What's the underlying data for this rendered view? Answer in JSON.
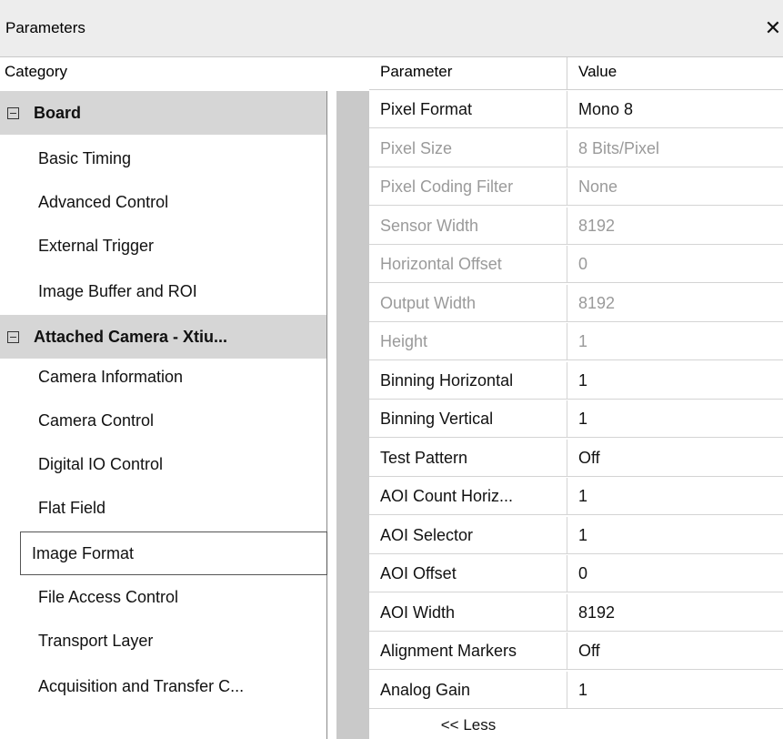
{
  "window": {
    "title": "Parameters",
    "close_glyph": "✕"
  },
  "headers": {
    "category": "Category",
    "parameter": "Parameter",
    "value": "Value"
  },
  "categories": [
    {
      "label": "Board",
      "type": "group"
    },
    {
      "label": "Basic Timing",
      "type": "item"
    },
    {
      "label": "Advanced Control",
      "type": "item"
    },
    {
      "label": "External Trigger",
      "type": "item"
    },
    {
      "label": "Image Buffer and ROI",
      "type": "item"
    },
    {
      "label": "Attached Camera - Xtiu...",
      "type": "group"
    },
    {
      "label": "Camera Information",
      "type": "item"
    },
    {
      "label": "Camera Control",
      "type": "item"
    },
    {
      "label": "Digital IO Control",
      "type": "item"
    },
    {
      "label": "Flat Field",
      "type": "item"
    },
    {
      "label": "Image Format",
      "type": "item",
      "selected": true
    },
    {
      "label": "File Access Control",
      "type": "item"
    },
    {
      "label": "Transport Layer",
      "type": "item"
    },
    {
      "label": "Acquisition and Transfer C...",
      "type": "item"
    }
  ],
  "parameters": [
    {
      "name": "Pixel Format",
      "value": "Mono 8",
      "enabled": true
    },
    {
      "name": "Pixel Size",
      "value": "8 Bits/Pixel",
      "enabled": false
    },
    {
      "name": "Pixel Coding Filter",
      "value": "None",
      "enabled": false
    },
    {
      "name": "Sensor Width",
      "value": "8192",
      "enabled": false
    },
    {
      "name": "Horizontal Offset",
      "value": "0",
      "enabled": false
    },
    {
      "name": "Output Width",
      "value": "8192",
      "enabled": false
    },
    {
      "name": "Height",
      "value": "1",
      "enabled": false
    },
    {
      "name": "Binning Horizontal",
      "value": "1",
      "enabled": true
    },
    {
      "name": "Binning Vertical",
      "value": "1",
      "enabled": true
    },
    {
      "name": "Test Pattern",
      "value": "Off",
      "enabled": true
    },
    {
      "name": "AOI Count Horiz...",
      "value": "1",
      "enabled": true
    },
    {
      "name": "AOI Selector",
      "value": "1",
      "enabled": true
    },
    {
      "name": "AOI Offset",
      "value": "0",
      "enabled": true
    },
    {
      "name": "AOI Width",
      "value": "8192",
      "enabled": true
    },
    {
      "name": "Alignment Markers",
      "value": "Off",
      "enabled": true
    },
    {
      "name": "Analog Gain",
      "value": "1",
      "enabled": true
    }
  ],
  "less_label": "<< Less"
}
